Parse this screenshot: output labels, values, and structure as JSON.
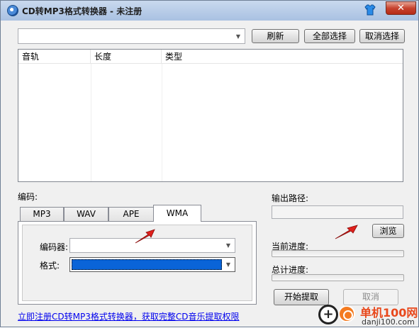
{
  "window": {
    "title": "CD转MP3格式转换器 - 未注册",
    "close_symbol": "✕"
  },
  "toolbar": {
    "drive_select_value": "",
    "refresh_label": "刷新",
    "select_all_label": "全部选择",
    "deselect_label": "取消选择"
  },
  "track_list": {
    "columns": [
      "音轨",
      "长度",
      "类型"
    ],
    "rows": []
  },
  "encoding": {
    "label": "编码:",
    "tabs": [
      "MP3",
      "WAV",
      "APE",
      "WMA"
    ],
    "active_tab": "WMA",
    "encoder_label": "编码器:",
    "encoder_value": "",
    "format_label": "格式:",
    "format_value": ""
  },
  "output": {
    "path_label": "输出路径:",
    "path_value": "",
    "browse_label": "浏览"
  },
  "progress": {
    "current_label": "当前进度:",
    "current_value": 0,
    "total_label": "总计进度:",
    "total_value": 0
  },
  "actions": {
    "start_label": "开始提取",
    "cancel_label": "取消"
  },
  "register_link": "立即注册CD转MP3格式转换器，获取完整CD音乐提取权限",
  "watermark": {
    "title": "单机100网",
    "subtitle": "danji100.com"
  },
  "colors": {
    "selection": "#0a64d8",
    "annotation_arrow": "#e0201c",
    "link": "#0000ee"
  },
  "icons": {
    "app": "cd-disc-icon",
    "skin": "tshirt-icon",
    "dropdown": "chevron-down-icon",
    "annotation": "red-arrow-icon"
  }
}
